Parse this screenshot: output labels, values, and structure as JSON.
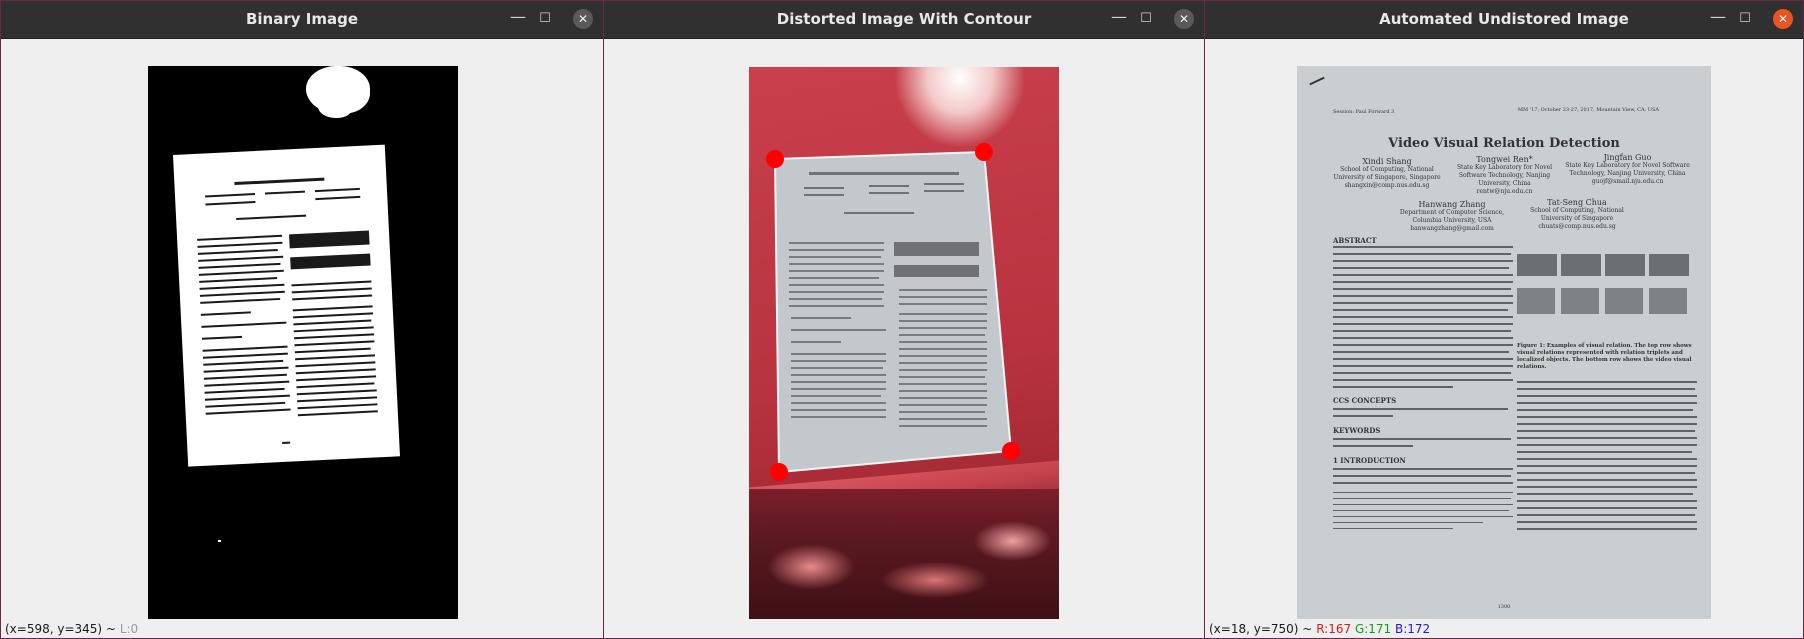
{
  "windows": [
    {
      "title": "Binary Image",
      "status": {
        "coords": "(x=598, y=345) ~",
        "level": "L:0"
      }
    },
    {
      "title": "Distorted Image With Contour"
    },
    {
      "title": "Automated Undistored Image",
      "status": {
        "coords": "(x=18, y=750) ~",
        "r": "R:167",
        "g": "G:171",
        "b": "B:172"
      }
    }
  ],
  "controls": {
    "minimize": "—",
    "maximize": "☐",
    "close": "✕"
  },
  "document": {
    "header_left": "Session: Paul Forward 3",
    "header_right": "MM '17, October 23-27, 2017, Mountain View, CA, USA",
    "paper_title": "Video Visual Relation Detection",
    "authors": [
      {
        "name": "Xindi Shang",
        "affil": "School of Computing, National University of Singapore, Singapore",
        "email": "shangxin@comp.nus.edu.sg"
      },
      {
        "name": "Tongwei Ren*",
        "affil": "State Key Laboratory for Novel Software Technology, Nanjing University, China",
        "email": "rentw@nju.edu.cn"
      },
      {
        "name": "Jingfan Guo",
        "affil": "State Key Laboratory for Novel Software Technology, Nanjing University, China",
        "email": "guojf@smail.nju.edu.cn"
      },
      {
        "name": "Hanwang Zhang",
        "affil": "Department of Computer Science, Columbia University, USA",
        "email": "hanwangzhang@gmail.com"
      },
      {
        "name": "Tat-Seng Chua",
        "affil": "School of Computing, National University of Singapore",
        "email": "chuats@comp.nus.edu.sg"
      }
    ],
    "sections": [
      "ABSTRACT",
      "CCS CONCEPTS",
      "KEYWORDS",
      "1   INTRODUCTION"
    ],
    "figure_caption": "Figure 1: Examples of visual relation. The top row shows visual relations represented with relation triplets and localized objects. The bottom row shows the video visual relations.",
    "page_number": "1300"
  }
}
